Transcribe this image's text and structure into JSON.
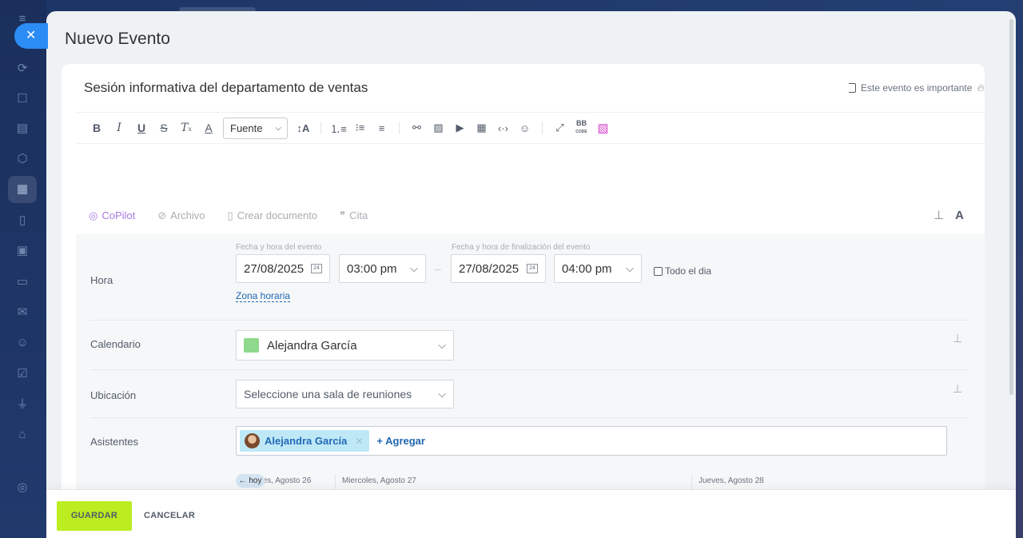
{
  "panel": {
    "title": "Nuevo Evento",
    "close_icon": "close-icon"
  },
  "event": {
    "name": "Sesión informativa del departamento de ventas",
    "important_label": "Este evento es importante"
  },
  "editor": {
    "font_select": "Fuente",
    "tools": [
      "bold-icon",
      "italic-icon",
      "underline-icon",
      "strikethrough-icon",
      "clear-format-icon",
      "text-color-icon",
      "font-size-icon",
      "numbered-list-icon",
      "bullet-list-icon",
      "align-icon",
      "link-icon",
      "image-icon",
      "video-icon",
      "table-icon",
      "code-icon",
      "emoji-icon",
      "fullscreen-icon",
      "bbcode-icon",
      "ai-image-icon"
    ],
    "bb_label": "BB",
    "bb_sub": "CODE"
  },
  "attachments": {
    "copilot": "CoPilot",
    "file": "Archivo",
    "create_doc": "Crear documento",
    "quote": "Cita"
  },
  "form": {
    "time": {
      "label": "Hora",
      "start_caption": "Fecha y hora del evento",
      "end_caption": "Fecha y hora de finalización del evento",
      "start_date": "27/08/2025",
      "start_time": "03:00 pm",
      "end_date": "27/08/2025",
      "end_time": "04:00 pm",
      "all_day": "Todo el dia",
      "timezone_link": "Zona horaria",
      "date_icon_text": "24"
    },
    "calendar": {
      "label": "Calendario",
      "value": "Alejandra García",
      "color": "#8ed98c"
    },
    "location": {
      "label": "Ubicación",
      "placeholder": "Seleccione una sala de reuniones"
    },
    "attendees": {
      "label": "Asistentes",
      "people": [
        "Alejandra García"
      ],
      "add_label": "+ Agregar"
    },
    "schedule": {
      "today": "← hoy",
      "days": [
        "artes, Agosto 26",
        "Miercoles, Agosto 27",
        "Jueves, Agosto 28"
      ]
    }
  },
  "footer": {
    "save": "GUARDAR",
    "cancel": "CANCELAR"
  },
  "colors": {
    "accent_blue": "#2b8cf5",
    "save_green": "#bbed21",
    "link_blue": "#2067b0"
  }
}
